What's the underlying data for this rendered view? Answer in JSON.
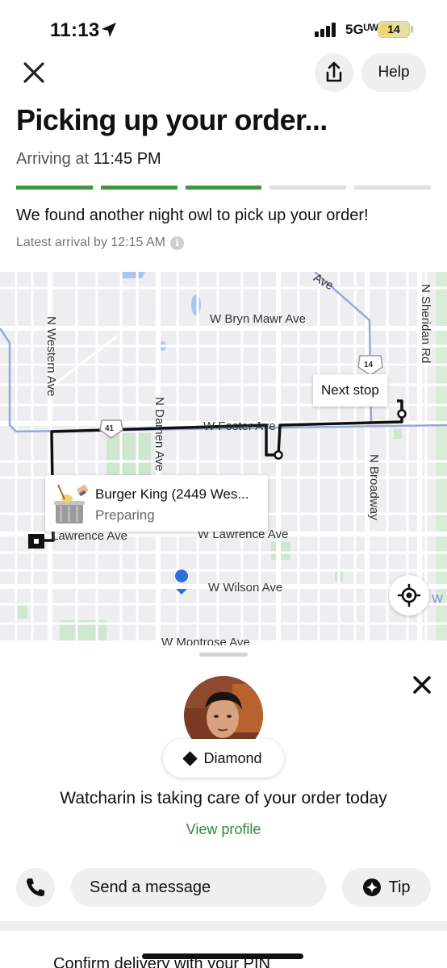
{
  "status_bar": {
    "time": "11:13",
    "network": "5Gᵁᵂ",
    "battery": "14"
  },
  "header": {
    "help_label": "Help"
  },
  "order": {
    "title": "Picking up your order...",
    "arriving_prefix": "Arriving at",
    "arriving_time": "11:45 PM",
    "progress_steps_total": 5,
    "progress_steps_done": 3,
    "note": "We found another night owl to pick up your order!",
    "latest_arrival": "Latest arrival by 12:15 AM"
  },
  "map": {
    "streets": {
      "bryn_mawr": "W Bryn Mawr Ave",
      "foster": "W Foster Ave",
      "lawrence_left": "Lawrence Ave",
      "lawrence_right": "W Lawrence Ave",
      "wilson": "W Wilson Ave",
      "montrose": "W Montrose Ave",
      "western": "N Western Ave",
      "damen": "N Damen Ave",
      "broadway": "N Broadway",
      "sheridan": "N Sheridan Rd",
      "ridge": "Ave",
      "wilson_right": "W"
    },
    "highway_shields": [
      "41",
      "14"
    ],
    "next_stop_label": "Next stop",
    "store": {
      "name": "Burger King (2449 Wes...",
      "status": "Preparing"
    }
  },
  "courier": {
    "rating_badge": "Diamond",
    "message": "Watcharin is taking care of your order today",
    "view_profile": "View profile"
  },
  "actions": {
    "message_placeholder": "Send a message",
    "tip_label": "Tip"
  },
  "next_section": {
    "title": "Confirm delivery with your PIN"
  },
  "colors": {
    "progress_done": "#3f9a3f",
    "link": "#2f8a3c",
    "route": "#111111",
    "user_dot": "#2f6fe0"
  }
}
